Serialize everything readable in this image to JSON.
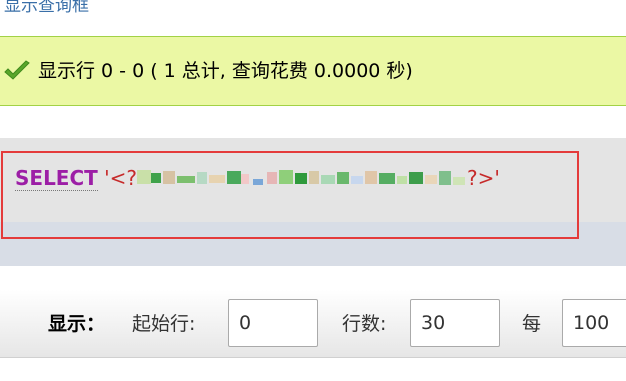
{
  "header": {
    "title": "显示查询框"
  },
  "result": {
    "message": "显示行 0 - 0 ( 1 总计, 查询花费 0.0000 秒)"
  },
  "sql": {
    "keyword": "SELECT",
    "prefix": "'<?",
    "suffix": "?>'"
  },
  "toolbar": {
    "show_label": "显示：",
    "start_row_label": "起始行:",
    "start_row_value": "0",
    "row_count_label": "行数:",
    "row_count_value": "30",
    "per_label": "每",
    "per_value": "100"
  },
  "colors": {
    "success_bg": "#ebf8a4",
    "check_green": "#5aa62b",
    "keyword_purple": "#9c1ea6",
    "string_red": "#c62a2a",
    "highlight_border": "#e43b3b"
  }
}
